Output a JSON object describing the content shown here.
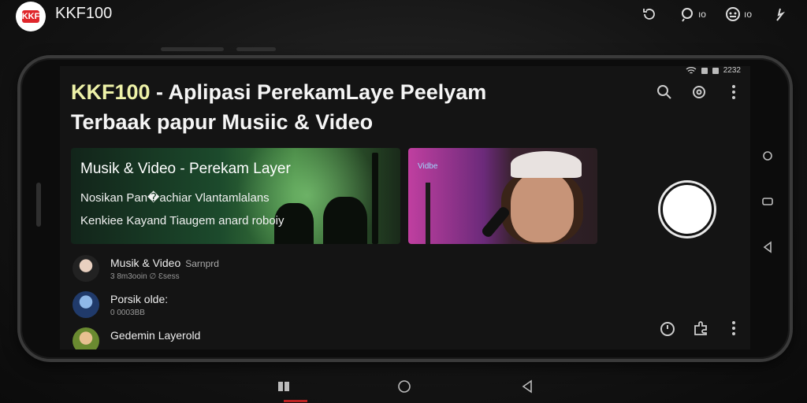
{
  "top_bar": {
    "app_title": "KKF100",
    "logo_label": "KKF",
    "indicators": [
      {
        "icon": "rotate-icon",
        "label": ""
      },
      {
        "icon": "location-icon",
        "label": "ıo"
      },
      {
        "icon": "gamepad-icon",
        "label": "ıo"
      },
      {
        "icon": "signal-icon",
        "label": ""
      }
    ]
  },
  "status_bar": {
    "time": "2232"
  },
  "header": {
    "title_highlight": "KKF100",
    "title_rest_line1": " - Aplipasi PerekamLaye Peelyam",
    "title_line2": "Terbaak papur Musiic & Video"
  },
  "featured": [
    {
      "title": "Musik & Video - Perekam Layer",
      "line1": "Nosikan Pan�achiar Vlantamlalans",
      "line2": "Kenkiee Kayand Tiaugem anard roboiy"
    },
    {
      "tag": "Vidbe"
    }
  ],
  "list": [
    {
      "name": "Musik & Video",
      "sub": "Sarnprd",
      "meta": "3 8m3ooin ∅ Ɛsess"
    },
    {
      "name": "Porsik olde:",
      "sub": "",
      "meta": "0 0003BB"
    },
    {
      "name": "Gedemin Layerold",
      "sub": "",
      "meta": ""
    }
  ],
  "colors": {
    "accent_highlight": "#eef2a8",
    "logo_red": "#e0262b"
  }
}
